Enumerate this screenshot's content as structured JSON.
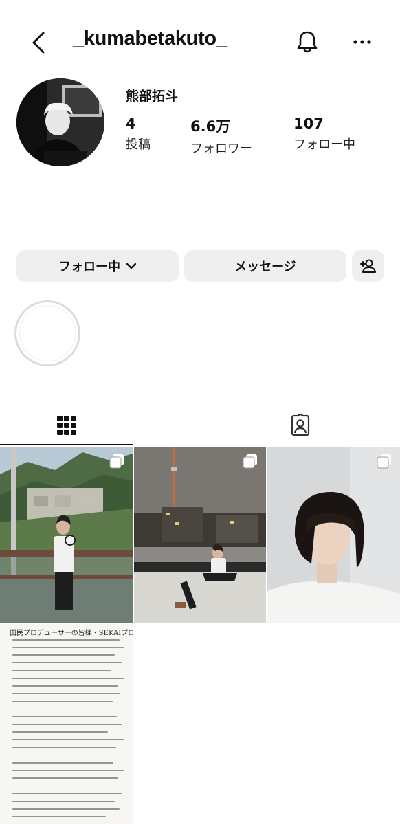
{
  "header": {
    "username": "_kumabetakuto_",
    "back_icon": "chevron-left-icon",
    "bell_icon": "bell-icon",
    "more_icon": "more-horizontal-icon"
  },
  "profile": {
    "display_name": "熊部拓斗",
    "stats": [
      {
        "value": "4",
        "label": "投稿"
      },
      {
        "value": "6.6万",
        "label": "フォロワー"
      },
      {
        "value": "107",
        "label": "フォロー中"
      }
    ]
  },
  "actions": {
    "follow_label": "フォロー中",
    "message_label": "メッセージ",
    "add_user_icon": "add-user-icon"
  },
  "tabs": {
    "grid_icon": "grid-icon",
    "tagged_icon": "tagged-person-icon"
  },
  "posts": {
    "note_title": "国民プロデューサーの皆様・SEKAIプロデューサーの皆様へ",
    "multi_icon": "carousel-icon"
  },
  "colors": {
    "button_bg": "#efefef",
    "text": "#111111",
    "highlight_ring": "#dcdcdc"
  }
}
